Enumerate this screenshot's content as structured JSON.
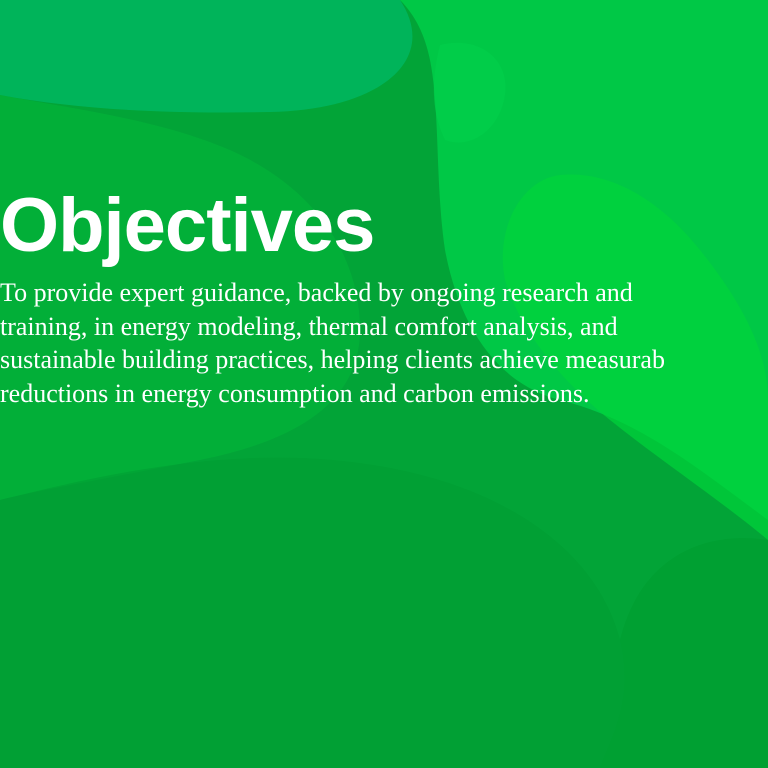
{
  "slide": {
    "title": "Objectives",
    "body_lines": [
      "To provide expert guidance, backed by ongoing research and",
      "training, in energy modeling, thermal comfort analysis, and",
      "sustainable building practices, helping clients achieve measurab",
      "reductions in energy consumption and carbon emissions."
    ]
  },
  "colors": {
    "background": "#02a437",
    "blob_light": "#00c846",
    "blob_teal": "#00b65e",
    "blob_mid": "#03b83a",
    "text": "#ffffff"
  }
}
